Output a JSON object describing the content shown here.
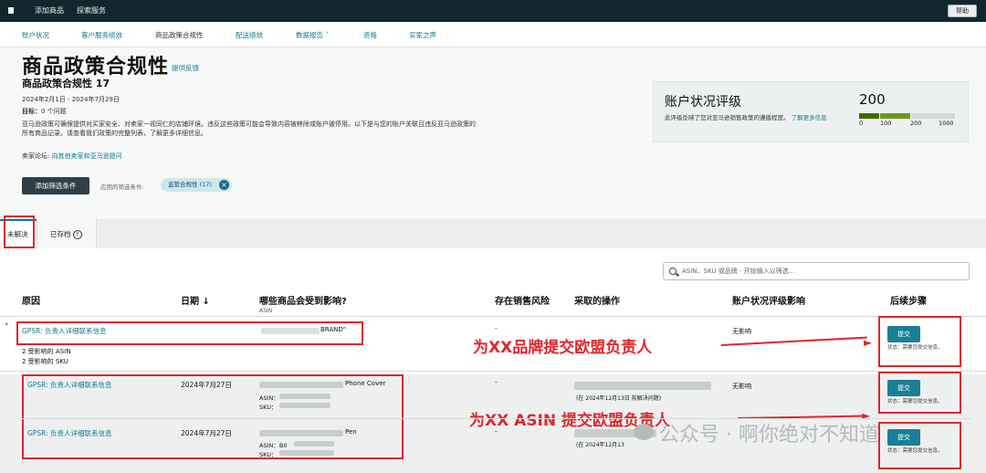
{
  "topbar": {
    "links": [
      "添加商品",
      "探索服务"
    ],
    "help": "帮助"
  },
  "nav": {
    "items": [
      "账户状况",
      "客户服务绩效",
      "商品政策合规性",
      "配送绩效",
      "数据报告",
      "资格",
      "买家之声"
    ],
    "active_index": 2
  },
  "header": {
    "title": "商品政策合规性",
    "feedback": "提供反馈",
    "subtitle": "商品政策合规性 17",
    "date_range": "2024年2月1日 - 2024年7月29日",
    "target_label": "目标：",
    "target_value": "0 个问题",
    "description": "亚马逊政策可确保提供对买家安全、对卖家一视同仁的店铺环境。违反这些政策可能会导致内容被移除或账户被停用。以下是与您的账户关联且违反亚马逊政策的所有商品记录。请查看我们政策的完整列表，了解更多详细信息。",
    "forum_label": "卖家论坛:",
    "forum_link": "向其他卖家和亚马逊提问",
    "add_filter_button": "添加筛选条件",
    "applied_filters_label": "应用的筛选条件:",
    "filter_chip": "监管合规性 (17)"
  },
  "account_health": {
    "title": "账户状况评级",
    "description": "此评级反映了您对亚马逊销售政策的遵循程度。",
    "learn_more": "了解更多信息",
    "score": "200",
    "scale_labels": [
      "0",
      "100",
      "200",
      "1000"
    ],
    "colors": {
      "red": "#c40000",
      "green_dark": "#3d6b00",
      "green": "#6a9a1f",
      "grey": "#d5d9da"
    }
  },
  "tabs": {
    "unresolved": "未解决",
    "archived": "已存档"
  },
  "search": {
    "placeholder": "ASIN、SKU 或品牌 - 开始输入以筛选..."
  },
  "table": {
    "headers": {
      "reason": "原因",
      "date": "日期 ↓",
      "products": "哪些商品会受到影响?",
      "products_sub": "ASIN",
      "risk": "存在销售风险",
      "action": "采取的操作",
      "impact": "账户状况评级影响",
      "next_steps": "后续步骤"
    },
    "row1": {
      "reason": "GPSR: 负责人详细联系信息",
      "affected_asin": "2 受影响的 ASIN",
      "affected_sku": "2 受影响的 SKU",
      "brand": "BRAND\"",
      "risk": "-",
      "impact": "无影响",
      "submit": "提交",
      "status": "状态：需要您提交信息。"
    },
    "row2": {
      "reason": "GPSR: 负责人详细联系信息",
      "date": "2024年7月27日",
      "product": "Phone Cover",
      "asin_label": "ASIN：",
      "sku_label": "SKU：",
      "risk": "-",
      "action_date": "(在 2024年12月13日 前解决问题)",
      "impact": "无影响",
      "submit": "提交",
      "status": "状态：需要您提交信息。"
    },
    "row3": {
      "reason": "GPSR: 负责人详细联系信息",
      "date": "2024年7月27日",
      "product": "Pen",
      "asin_label": "ASIN：",
      "asin_prefix": "B0",
      "sku_label": "SKU：",
      "risk": "-",
      "action_date": "(在 2024年12月13",
      "submit": "提交",
      "status": "状态：需要您提交信息。"
    }
  },
  "annotations": {
    "brand_note": "为XX品牌提交欧盟负责人",
    "asin_note": "为XX ASIN 提交欧盟负责人",
    "color": "#e0262a"
  },
  "watermark": {
    "text": "公众号 · 啊你绝对不知道"
  }
}
